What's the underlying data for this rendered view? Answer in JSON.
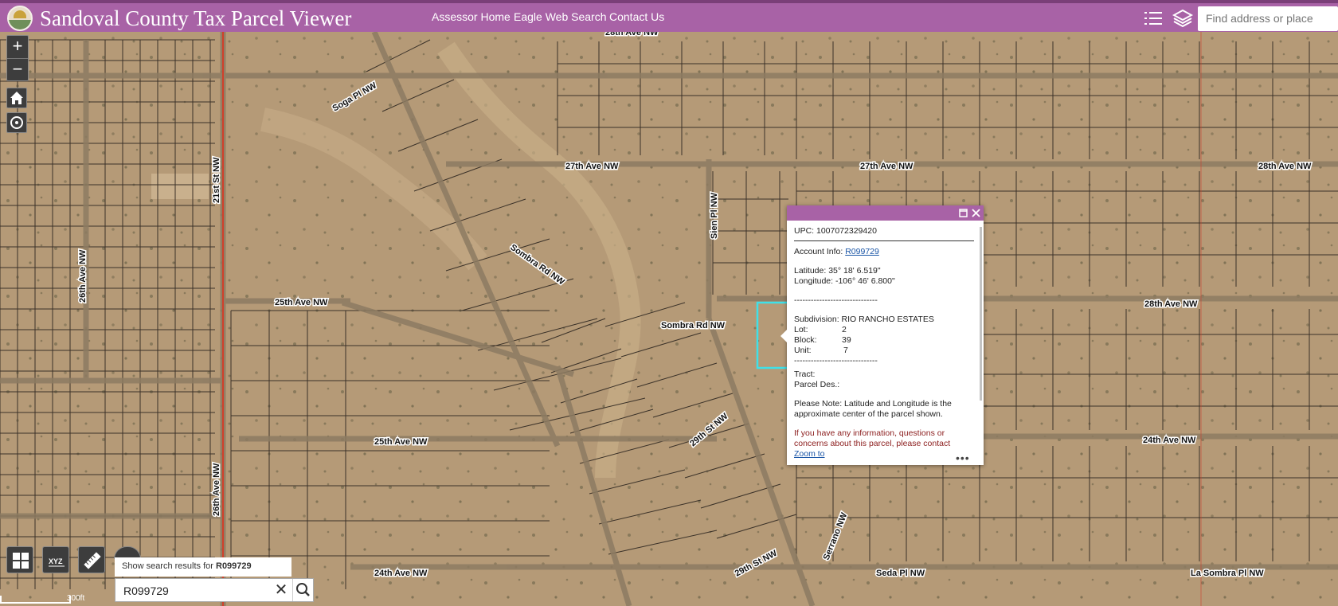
{
  "header": {
    "title": "Sandoval County Tax Parcel Viewer",
    "links": [
      "Assessor Home",
      "Eagle Web Search",
      "Contact Us"
    ],
    "search_placeholder": "Find address or place",
    "icons": [
      "legend-list-icon",
      "layers-icon"
    ]
  },
  "map": {
    "road_labels": [
      "28th Ave NW",
      "27th Ave NW",
      "27th Ave NW",
      "28th Ave NW",
      "28th Ave NW",
      "25th Ave NW",
      "25th Ave NW",
      "24th Ave NW",
      "24th Ave NW",
      "Seda Pl NW",
      "La Sombra Pl NW",
      "Soga Pl NW",
      "Sombra Rd NW",
      "Sombra Rd NW",
      "Sien Pl NW",
      "Serrano NW",
      "29th St NW",
      "29th St NW",
      "21st St NW",
      "26th Ave NW",
      "26th Ave NW"
    ],
    "zoom_in": "+",
    "zoom_out": "−",
    "scale_label": "300ft"
  },
  "popup": {
    "upc": "UPC: 1007072329420",
    "account_label": "Account Info:",
    "account_link": "R099729",
    "latitude": "Latitude: 35° 18' 6.519\"",
    "longitude": "Longitude: -106° 46' 6.800\"",
    "divider": "------------------------------",
    "subdivision": "Subdivision: RIO RANCHO ESTATES",
    "lot_label": "Lot:",
    "lot": "2",
    "block_label": "Block:",
    "block": "39",
    "unit_label": "Unit:",
    "unit": "7",
    "tract": "Tract:",
    "parcel_des": "Parcel Des.:",
    "note": "Please Note: Latitude and Longitude is the approximate center of the parcel shown.",
    "contact": "If you have any information, questions or concerns about this parcel, please contact",
    "zoom_to": "Zoom to",
    "more": "•••"
  },
  "search": {
    "suggestion_prefix": "Show search results for",
    "suggestion_term": "R099729",
    "value": "R099729",
    "clear": "✕"
  },
  "colors": {
    "header": "#a862a6",
    "map_ground": "#b59a77",
    "parcel_lines": "#3a3128",
    "selected_parcel": "#3fe0e8",
    "county_line": "#d0402b"
  }
}
